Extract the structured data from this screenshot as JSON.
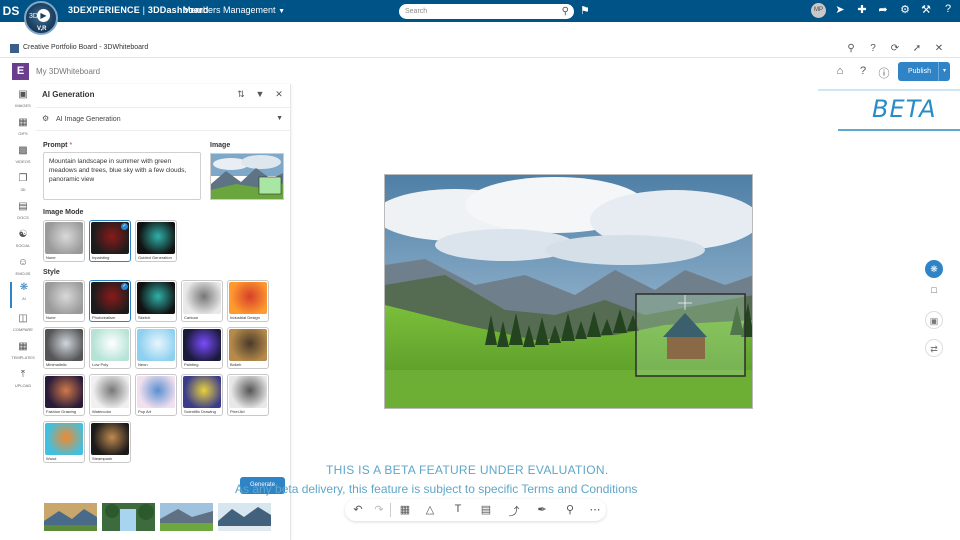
{
  "topbar": {
    "ds_logo": "DS",
    "compass": {
      "left": "3D",
      "center": "▶",
      "bottom": "V,R"
    },
    "brand_bold": "3DEXPERIENCE",
    "brand_sep": " | ",
    "brand_dash": "3DDashboard",
    "dashboard_menu": "Members Management",
    "search_placeholder": "Search",
    "avatar_initials": "MP",
    "colors": {
      "bar": "#005386",
      "accent": "#2f84c7"
    }
  },
  "app_header": {
    "title": "Creative Portfolio Board - 3DWhiteboard"
  },
  "whiteboard": {
    "logo": "E",
    "name": "My 3DWhiteboard",
    "publish_label": "Publish",
    "publish_caret": "▾"
  },
  "rail": [
    {
      "label": "IMAGES",
      "icon": "image-icon"
    },
    {
      "label": "GIFS",
      "icon": "gif-icon"
    },
    {
      "label": "VIDEOS",
      "icon": "video-icon"
    },
    {
      "label": "3D",
      "icon": "cube-icon"
    },
    {
      "label": "DOCS",
      "icon": "document-icon"
    },
    {
      "label": "SOCIAL",
      "icon": "social-icon"
    },
    {
      "label": "EMOJIS",
      "icon": "emoji-icon"
    },
    {
      "label": "AI",
      "icon": "ai-icon",
      "active": true
    },
    {
      "label": "COMPARE",
      "icon": "compare-icon"
    },
    {
      "label": "TEMPLATES",
      "icon": "templates-icon"
    },
    {
      "label": "UPLOAD",
      "icon": "upload-icon"
    }
  ],
  "panel": {
    "title": "AI Generation",
    "generator": "AI Image Generation",
    "prompt_label": "Prompt",
    "prompt_required": "*",
    "prompt_value": "Mountain landscape in summer with green meadows and trees, blue sky with a few clouds, panoramic view",
    "image_label": "Image",
    "image_mode_label": "Image Mode",
    "image_modes": [
      {
        "label": "None",
        "selected": false
      },
      {
        "label": "Inpainting",
        "selected": true
      },
      {
        "label": "Guided Generation",
        "selected": false
      }
    ],
    "style_label": "Style",
    "styles": [
      {
        "label": "None",
        "selected": false
      },
      {
        "label": "Photorealism",
        "selected": true
      },
      {
        "label": "Sketch",
        "selected": false
      },
      {
        "label": "Cartoon",
        "selected": false
      },
      {
        "label": "Industrial Design",
        "selected": false
      },
      {
        "label": "Minimalistic",
        "selected": false
      },
      {
        "label": "Low Poly",
        "selected": false
      },
      {
        "label": "Neon",
        "selected": false
      },
      {
        "label": "Painting",
        "selected": false
      },
      {
        "label": "Bokeh",
        "selected": false
      },
      {
        "label": "Fashion Drawing",
        "selected": false
      },
      {
        "label": "Watercolor",
        "selected": false
      },
      {
        "label": "Pop Art",
        "selected": false
      },
      {
        "label": "Scientific Drawing",
        "selected": false
      },
      {
        "label": "Pixel Art",
        "selected": false
      },
      {
        "label": "Wood",
        "selected": false
      },
      {
        "label": "Steampunk",
        "selected": false
      }
    ],
    "generate_label": "Generate"
  },
  "banner": {
    "beta": "BETA",
    "notice_line1": "THIS IS A BETA FEATURE UNDER EVALUATION.",
    "notice_line2": "As any beta delivery, this feature is subject to specific Terms and Conditions"
  }
}
